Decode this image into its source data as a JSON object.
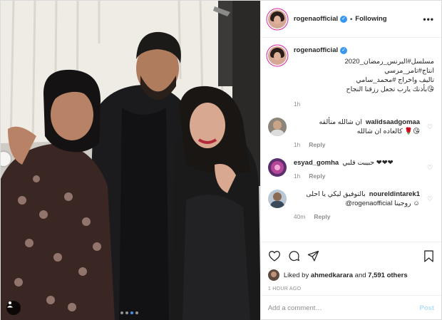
{
  "post": {
    "author": "rogenaofficial",
    "follow_separator": "•",
    "follow_state": "Following",
    "more": "•••",
    "carousel": {
      "slides": 3,
      "active": 2
    }
  },
  "caption": {
    "author": "rogenaofficial",
    "line1": "مسلسل#البرنس_رمضان_2020 انتاج#تامر_مرسي",
    "line2": "تاليف واخراج #محمد_سامي",
    "line3": "😘بأذنك يارب تجعل رزقنا النجاح",
    "time": "1h"
  },
  "comments": [
    {
      "user": "walidsaadgomaa",
      "text_line1": "ان شالله متألقه",
      "text_line2": "😘🌹 كالعاده ان شالله",
      "time": "1h",
      "reply": "Reply"
    },
    {
      "user": "esyad_gomha",
      "text_line1": "حبيبت قلبي ❤❤❤",
      "time": "1h",
      "reply": "Reply"
    },
    {
      "user": "noureldintarek1",
      "text_line1": "بالتوفيق ليكي يا احلى",
      "text_line2": "@rogenaofficial روجينا ☺",
      "time": "40m",
      "reply": "Reply"
    }
  ],
  "likes": {
    "prefix": "Liked by",
    "user": "ahmedkarara",
    "middle": "and",
    "others": "7,591 others"
  },
  "timestamp": "1 HOUR AGO",
  "add_comment": {
    "placeholder": "Add a comment…",
    "post_label": "Post"
  },
  "colors": {
    "accent": "#3897f0",
    "muted": "#8e8e8e",
    "text": "#262626",
    "post_disabled": "#b2dffc"
  },
  "icons": [
    "heart-icon",
    "comment-icon",
    "share-icon",
    "bookmark-icon",
    "tag-user-icon",
    "chevron-left-icon",
    "more-options-icon",
    "verified-icon"
  ]
}
